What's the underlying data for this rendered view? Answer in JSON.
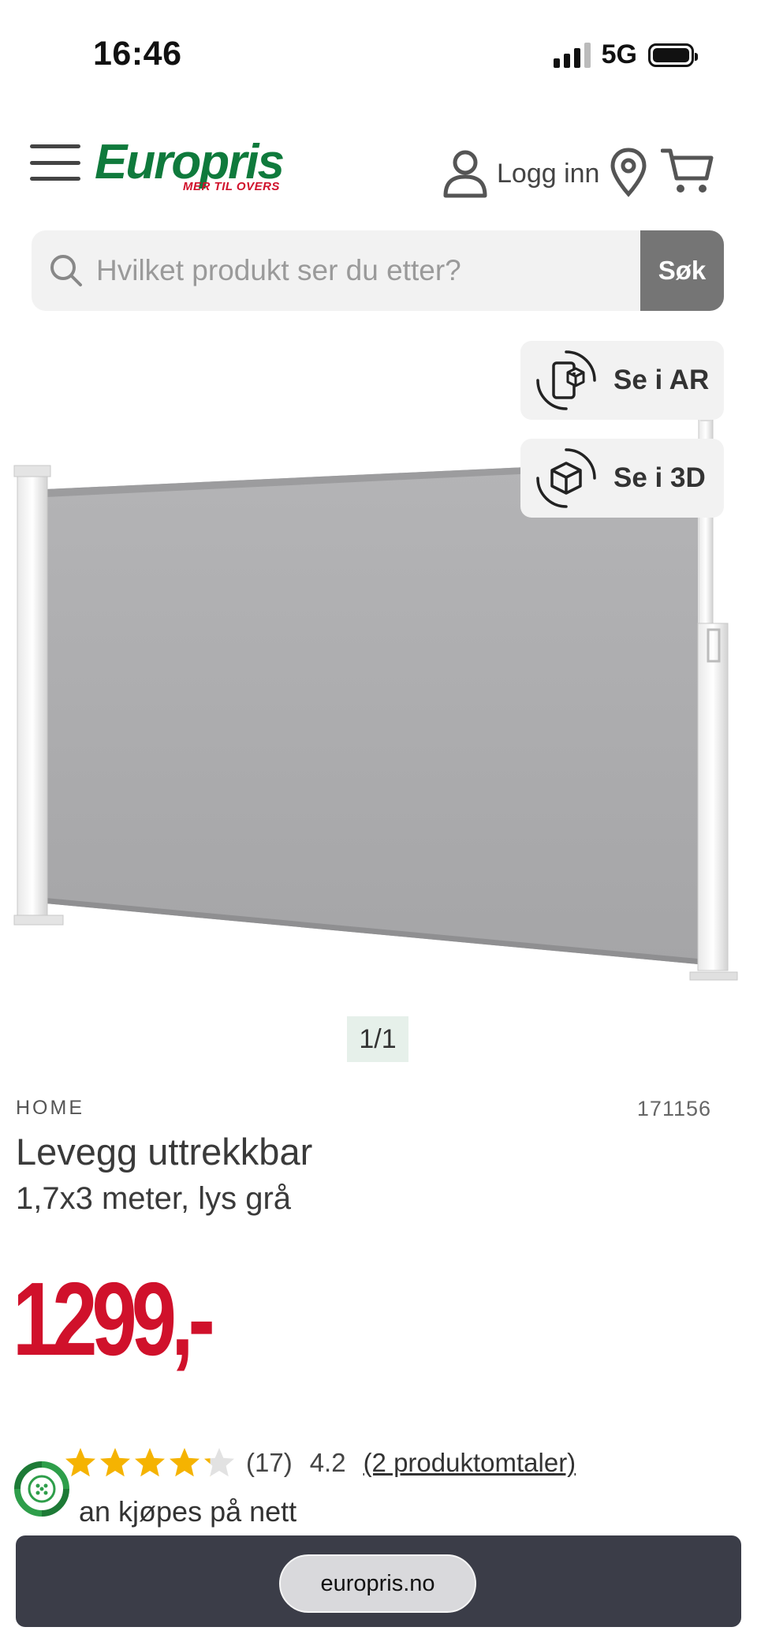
{
  "status_bar": {
    "time": "16:46",
    "network": "5G"
  },
  "header": {
    "logo_text": "Europris",
    "logo_tagline": "MER TIL OVERS",
    "login_label": "Logg inn"
  },
  "search": {
    "placeholder": "Hvilket produkt ser du etter?",
    "button_label": "Søk"
  },
  "view_options": {
    "ar_label": "Se i AR",
    "three_d_label": "Se i 3D"
  },
  "gallery": {
    "counter": "1/1"
  },
  "product": {
    "brand": "HOME",
    "sku": "171156",
    "title": "Levegg uttrekkbar",
    "subtitle": "1,7x3 meter, lys grå",
    "price": "1299,-",
    "rating_count": "(17)",
    "rating_value": "4.2",
    "rating_stars": 4.2,
    "reviews_link": "(2 produktomtaler)",
    "availability": "an kjøpes på nett"
  },
  "browser": {
    "url": "europris.no"
  },
  "colors": {
    "brand_green": "#0f7a3c",
    "price_red": "#d0112b",
    "star": "#f5b301"
  }
}
